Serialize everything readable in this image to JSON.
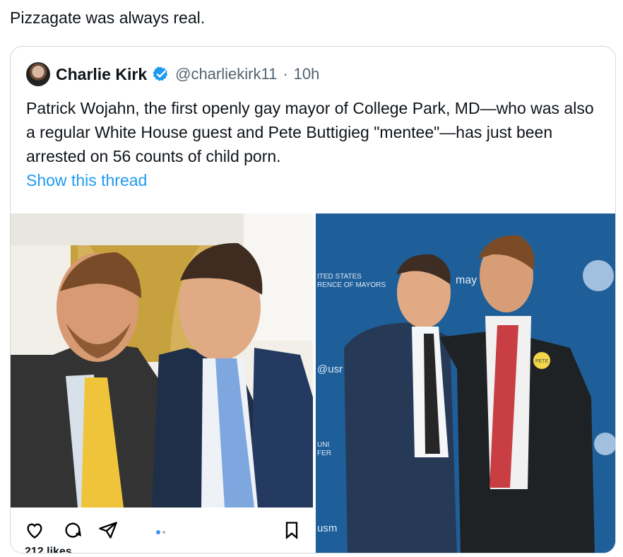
{
  "top_text": "Pizzagate was always real.",
  "quoted_tweet": {
    "author": "Charlie Kirk",
    "handle": "@charliekirk11",
    "separator": "·",
    "time": "10h",
    "text": "Patrick Wojahn, the first openly gay mayor of College Park, MD—who was also a regular White House guest and Pete Buttigieg \"mentee\"—has just been arrested on 56 counts of child porn.",
    "show_thread": "Show this thread"
  },
  "media": {
    "likes_text": "212 likes",
    "sign_text_1": "ITED STATES",
    "sign_text_2": "RENCE OF MAYORS",
    "sign_text_3": "may",
    "sign_text_4": "@usr",
    "sign_text_5": "UNI",
    "sign_text_6": "FER",
    "sign_text_7": "usm",
    "button_text": "PETE"
  },
  "colors": {
    "accent": "#1d9bf0",
    "text": "#0f1419",
    "muted": "#536471",
    "border": "#cfd9de"
  }
}
